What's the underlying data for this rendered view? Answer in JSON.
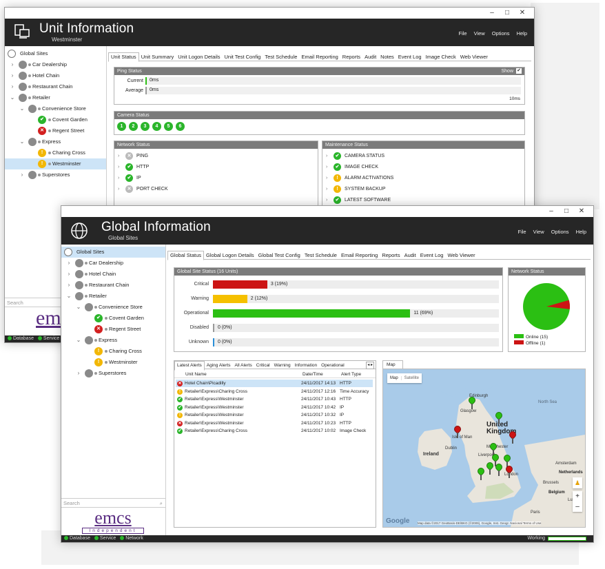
{
  "window_controls": {
    "minimize": "–",
    "maximize": "□",
    "close": "✕"
  },
  "menu": [
    "File",
    "View",
    "Options",
    "Help"
  ],
  "unit_window": {
    "title": "Unit Information",
    "subtitle": "Westminster",
    "tabs": [
      "Unit Status",
      "Unit Summary",
      "Unit Logon Details",
      "Unit Test Config",
      "Test Schedule",
      "Email Reporting",
      "Reports",
      "Audit",
      "Notes",
      "Event Log",
      "Image Check",
      "Web Viewer"
    ],
    "tree": [
      {
        "label": "Global Sites",
        "level": 0,
        "icon": "globe",
        "chev": ""
      },
      {
        "label": "Car Dealership",
        "level": 1,
        "icon": "group",
        "chev": ">"
      },
      {
        "label": "Hotel Chain",
        "level": 1,
        "icon": "group",
        "chev": ">"
      },
      {
        "label": "Restaurant Chain",
        "level": 1,
        "icon": "group",
        "chev": ">"
      },
      {
        "label": "Retailer",
        "level": 1,
        "icon": "group",
        "chev": "v"
      },
      {
        "label": "Convenience Store",
        "level": 2,
        "icon": "group",
        "chev": "v"
      },
      {
        "label": "Covent Garden",
        "level": 3,
        "icon": "ok",
        "chev": ""
      },
      {
        "label": "Regent Street",
        "level": 3,
        "icon": "err",
        "chev": ""
      },
      {
        "label": "Express",
        "level": 2,
        "icon": "group",
        "chev": "v"
      },
      {
        "label": "Charing Cross",
        "level": 3,
        "icon": "warn",
        "chev": ""
      },
      {
        "label": "Westminster",
        "level": 3,
        "icon": "warn",
        "chev": "",
        "selected": true
      },
      {
        "label": "Superstores",
        "level": 2,
        "icon": "group",
        "chev": ">"
      }
    ],
    "ping": {
      "title": "Ping Status",
      "show_label": "Show",
      "current_label": "Current",
      "current_value": "0ms",
      "average_label": "Average",
      "average_value": "0ms",
      "scale_max": "10ms"
    },
    "camera": {
      "title": "Camera Status",
      "cameras": [
        "1",
        "2",
        "3",
        "4",
        "5",
        "6"
      ]
    },
    "network": {
      "title": "Network Status",
      "items": [
        {
          "label": "PING",
          "state": "grey"
        },
        {
          "label": "HTTP",
          "state": "ok"
        },
        {
          "label": "IP",
          "state": "ok"
        },
        {
          "label": "PORT CHECK",
          "state": "grey"
        }
      ]
    },
    "maintenance": {
      "title": "Maintenance Status",
      "items": [
        {
          "label": "CAMERA STATUS",
          "state": "ok"
        },
        {
          "label": "IMAGE CHECK",
          "state": "ok"
        },
        {
          "label": "ALARM ACTIVATIONS",
          "state": "warn"
        },
        {
          "label": "SYSTEM BACKUP",
          "state": "warn"
        },
        {
          "label": "LATEST SOFTWARE",
          "state": "ok"
        }
      ]
    },
    "search_placeholder": "Search",
    "logo": "emc",
    "logo_sub": "Independent",
    "status": [
      "Database",
      "Service"
    ]
  },
  "global_window": {
    "title": "Global Information",
    "subtitle": "Global Sites",
    "tabs": [
      "Global Status",
      "Global Logon Details",
      "Global Test Config",
      "Test Schedule",
      "Email Reporting",
      "Reports",
      "Audit",
      "Event Log",
      "Web Viewer"
    ],
    "tree": [
      {
        "label": "Global Sites",
        "level": 0,
        "icon": "globe",
        "chev": "",
        "selected": true
      },
      {
        "label": "Car Dealership",
        "level": 1,
        "icon": "group",
        "chev": ">"
      },
      {
        "label": "Hotel Chain",
        "level": 1,
        "icon": "group",
        "chev": ">"
      },
      {
        "label": "Restaurant Chain",
        "level": 1,
        "icon": "group",
        "chev": ">"
      },
      {
        "label": "Retailer",
        "level": 1,
        "icon": "group",
        "chev": "v"
      },
      {
        "label": "Convenience Store",
        "level": 2,
        "icon": "group",
        "chev": "v"
      },
      {
        "label": "Covent Garden",
        "level": 3,
        "icon": "ok",
        "chev": ""
      },
      {
        "label": "Regent Street",
        "level": 3,
        "icon": "err",
        "chev": ""
      },
      {
        "label": "Express",
        "level": 2,
        "icon": "group",
        "chev": "v"
      },
      {
        "label": "Charing Cross",
        "level": 3,
        "icon": "warn",
        "chev": ""
      },
      {
        "label": "Westminster",
        "level": 3,
        "icon": "warn",
        "chev": ""
      },
      {
        "label": "Superstores",
        "level": 2,
        "icon": "group",
        "chev": ">"
      }
    ],
    "site_status": {
      "title": "Global Site Status (16 Units)",
      "rows": [
        {
          "label": "Critical",
          "fraction": 0.19,
          "value": "3 (19%)",
          "color": "#cc1414"
        },
        {
          "label": "Warning",
          "fraction": 0.12,
          "value": "2 (12%)",
          "color": "#f5c000"
        },
        {
          "label": "Operational",
          "fraction": 0.69,
          "value": "11 (69%)",
          "color": "#2bbf13"
        },
        {
          "label": "Disabled",
          "fraction": 0,
          "value": "0 (0%)",
          "color": "#999999"
        },
        {
          "label": "Unknown",
          "fraction": 0,
          "value": "0 (0%)",
          "color": "#2a8fd8"
        }
      ]
    },
    "network_status": {
      "title": "Network Status",
      "online_label": "Online (15)",
      "offline_label": "Offline (1)",
      "online": 15,
      "offline": 1,
      "online_color": "#2bbf13",
      "offline_color": "#cc1414"
    },
    "alert_tabs": [
      "Latest Alerts",
      "Aging Alerts",
      "All Alerts",
      "Critical",
      "Warning",
      "Information",
      "Operational"
    ],
    "alert_columns": {
      "name": "Unit Name",
      "date": "Date/Time",
      "type": "Alert Type"
    },
    "alerts": [
      {
        "state": "err",
        "name": "Hotel Chain\\Picadilly",
        "date": "24/11/2017 14:13",
        "type": "HTTP",
        "selected": true
      },
      {
        "state": "warn",
        "name": "Retailer\\Express\\Charing Cross",
        "date": "24/11/2017 12:16",
        "type": "Time Accuracy"
      },
      {
        "state": "ok",
        "name": "Retailer\\Express\\Westminster",
        "date": "24/11/2017 10:43",
        "type": "HTTP"
      },
      {
        "state": "ok",
        "name": "Retailer\\Express\\Westminster",
        "date": "24/11/2017 10:42",
        "type": "IP"
      },
      {
        "state": "warn",
        "name": "Retailer\\Express\\Westminster",
        "date": "24/11/2017 10:32",
        "type": "IP"
      },
      {
        "state": "err",
        "name": "Retailer\\Express\\Westminster",
        "date": "24/11/2017 10:23",
        "type": "HTTP"
      },
      {
        "state": "ok",
        "name": "Retailer\\Express\\Charing Cross",
        "date": "24/11/2017 10:02",
        "type": "Image Check"
      }
    ],
    "map": {
      "tab": "Map",
      "btn_map": "Map",
      "btn_satellite": "Satellite",
      "labels": {
        "edinburgh": "Edinburgh",
        "glasgow": "Glasgow",
        "uk": "United Kingdom",
        "isle": "Isle of Man",
        "dublin": "Dublin",
        "ireland": "Ireland",
        "manchester": "Manchester",
        "liverpool": "Liverpool",
        "london": "London",
        "north_sea": "North Sea",
        "amsterdam": "Amsterdam",
        "netherlands": "Netherlands",
        "brussels": "Brussels",
        "belgium": "Belgium",
        "luxem": "Luxem",
        "paris": "Paris"
      },
      "google": "Google",
      "attribution": "Map data ©2017 GeoBasis-DE/BKG (©2009), Google, Inst. Geogr. Nacional   Terms of Use",
      "zoom_in": "+",
      "zoom_out": "–"
    },
    "search_placeholder": "Search",
    "logo": "emcs",
    "logo_sub": "Independent",
    "status": [
      "Database",
      "Service",
      "Network"
    ],
    "working": "Working"
  }
}
